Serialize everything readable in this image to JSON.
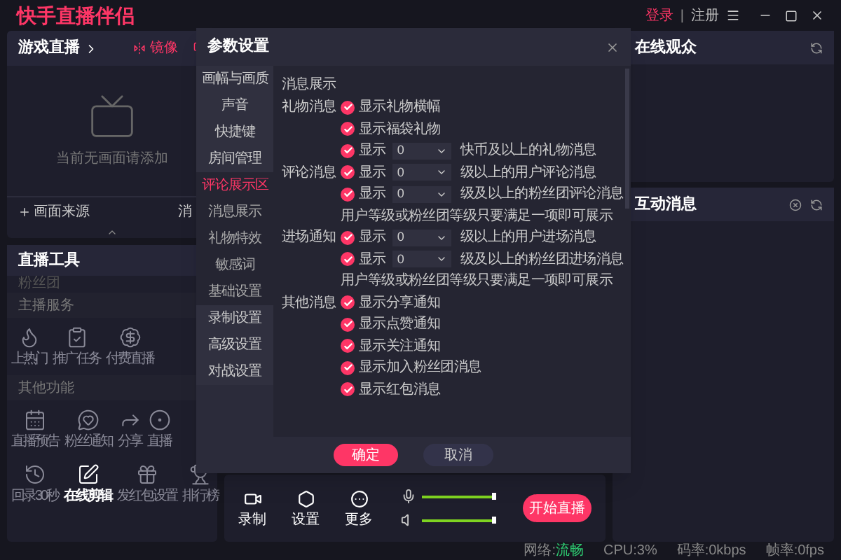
{
  "app_title": "快手直播伴侣",
  "account": {
    "login": "登录",
    "separator": "|",
    "register": "注册"
  },
  "scene_panel": {
    "title": "游戏直播",
    "mirror": "镜像",
    "empty_hint": "当前无画面请添加",
    "add_source": "画面来源",
    "side_tab": "消"
  },
  "tools_panel": {
    "title": "直播工具",
    "faded_item": "粉丝团",
    "sections": [
      {
        "title": "主播服务",
        "items": [
          {
            "label": "上热门",
            "selected": false
          },
          {
            "label": "推广任务",
            "selected": false
          },
          {
            "label": "付费直播",
            "selected": false
          }
        ]
      },
      {
        "title": "其他功能",
        "items": [
          {
            "label": "直播预告",
            "selected": false
          },
          {
            "label": "粉丝通知",
            "selected": false
          },
          {
            "label": "分享",
            "selected": false
          },
          {
            "label": "直播",
            "selected": false
          },
          {
            "label": "回录30秒",
            "selected": false
          },
          {
            "label": "在线剪辑",
            "selected": true
          },
          {
            "label": "发红包设置",
            "selected": false
          },
          {
            "label": "排行榜",
            "selected": false
          }
        ]
      }
    ]
  },
  "settings_dialog": {
    "title": "参数设置",
    "sidebar": [
      {
        "label": "画幅与画质",
        "selected": false
      },
      {
        "label": "声音",
        "selected": false
      },
      {
        "label": "快捷键",
        "selected": false
      },
      {
        "label": "房间管理",
        "selected": false,
        "children": [
          {
            "label": "评论展示区",
            "selected": true
          },
          {
            "label": "消息展示",
            "selected": false
          },
          {
            "label": "礼物特效",
            "selected": false
          },
          {
            "label": "敏感词",
            "selected": false
          },
          {
            "label": "基础设置",
            "selected": false
          }
        ]
      },
      {
        "label": "录制设置",
        "selected": false
      },
      {
        "label": "高级设置",
        "selected": false
      },
      {
        "label": "对战设置",
        "selected": false
      }
    ],
    "heading": "消息展示",
    "groups": [
      {
        "label": "礼物消息",
        "rows": [
          {
            "kind": "check",
            "checked": true,
            "text": "显示礼物横幅"
          },
          {
            "kind": "check",
            "checked": true,
            "text": "显示福袋礼物"
          },
          {
            "kind": "select",
            "checked": true,
            "text": "显示",
            "value": "0",
            "suffix": "快币及以上的礼物消息"
          }
        ]
      },
      {
        "label": "评论消息",
        "rows": [
          {
            "kind": "select",
            "checked": true,
            "text": "显示",
            "value": "0",
            "suffix": "级以上的用户评论消息"
          },
          {
            "kind": "select",
            "checked": true,
            "text": "显示",
            "value": "0",
            "suffix": "级及以上的粉丝团评论消息"
          },
          {
            "kind": "note",
            "text": "用户等级或粉丝团等级只要满足一项即可展示"
          }
        ]
      },
      {
        "label": "进场通知",
        "rows": [
          {
            "kind": "select",
            "checked": true,
            "text": "显示",
            "value": "0",
            "suffix": "级以上的用户进场消息"
          },
          {
            "kind": "select",
            "checked": true,
            "text": "显示",
            "value": "0",
            "suffix": "级及以上的粉丝团进场消息"
          },
          {
            "kind": "note",
            "text": "用户等级或粉丝团等级只要满足一项即可展示"
          }
        ]
      },
      {
        "label": "其他消息",
        "rows": [
          {
            "kind": "check",
            "checked": true,
            "text": "显示分享通知"
          },
          {
            "kind": "check",
            "checked": true,
            "text": "显示点赞通知"
          },
          {
            "kind": "check",
            "checked": true,
            "text": "显示关注通知"
          },
          {
            "kind": "check",
            "checked": true,
            "text": "显示加入粉丝团消息"
          },
          {
            "kind": "check",
            "checked": true,
            "text": "显示红包消息"
          }
        ]
      }
    ],
    "confirm": "确定",
    "cancel": "取消"
  },
  "control_bar": {
    "actions": [
      "录制",
      "设置",
      "更多"
    ],
    "mic": {
      "level": 1
    },
    "speaker": {
      "level": 1
    },
    "start": "开始直播"
  },
  "viewers_panel": {
    "title": "在线观众"
  },
  "messages_panel": {
    "title": "互动消息"
  },
  "status_bar": [
    {
      "label": "网络:",
      "value": "流畅",
      "highlight": true
    },
    {
      "label": "CPU:",
      "value": "3%",
      "highlight": false
    },
    {
      "label": "码率:",
      "value": "0kbps",
      "highlight": false
    },
    {
      "label": "帧率:",
      "value": "0fps",
      "highlight": false
    }
  ]
}
